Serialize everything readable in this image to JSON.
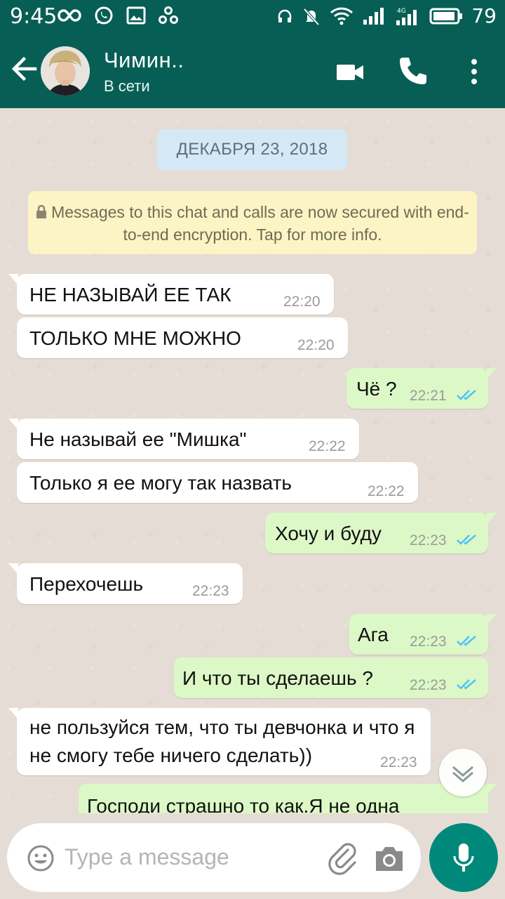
{
  "status_bar": {
    "time": "9:45",
    "battery_level": "79",
    "left_icons": [
      "infinity-icon",
      "whatsapp-icon",
      "gallery-icon",
      "share-icon"
    ],
    "right_icons": [
      "headset-icon",
      "mute-icon",
      "wifi-icon",
      "signal-icon",
      "signal-4g-icon",
      "battery-icon"
    ]
  },
  "header": {
    "contact_name": "Чимин..",
    "contact_status": "В сети",
    "actions": [
      "video-call-icon",
      "call-icon",
      "more-icon"
    ]
  },
  "chat": {
    "date_label": "ДЕКАБРЯ 23, 2018",
    "encryption_notice": "Messages to this chat and calls are now secured with end-to-end encryption. Tap for more info.",
    "messages": [
      {
        "direction": "in",
        "text": "НЕ НАЗЫВАЙ ЕЕ ТАК",
        "time": "22:20"
      },
      {
        "direction": "in",
        "text": "ТОЛЬКО МНЕ МОЖНО",
        "time": "22:20"
      },
      {
        "direction": "out",
        "text": "Чё ?",
        "time": "22:21",
        "status": "read"
      },
      {
        "direction": "in",
        "text": "Не называй ее \"Мишка\"",
        "time": "22:22"
      },
      {
        "direction": "in",
        "text": "Только я ее могу так назвать",
        "time": "22:22"
      },
      {
        "direction": "out",
        "text": "Хочу и буду",
        "time": "22:23",
        "status": "read"
      },
      {
        "direction": "in",
        "text": "Перехочешь",
        "time": "22:23"
      },
      {
        "direction": "out",
        "text": "Ага",
        "time": "22:23",
        "status": "read"
      },
      {
        "direction": "out",
        "text": "И что ты сделаешь ?",
        "time": "22:23",
        "status": "read"
      },
      {
        "direction": "in",
        "text": "не пользуйся тем, что ты девчонка и что я не смогу тебе ничего сделать))",
        "time": "22:23"
      },
      {
        "direction": "out",
        "text": "Господи страшно то как.Я не одна",
        "time": ""
      }
    ]
  },
  "input_bar": {
    "placeholder": "Type a message"
  },
  "colors": {
    "header": "#075e54",
    "incoming_bubble": "#ffffff",
    "outgoing_bubble": "#dcf8c6",
    "read_ticks": "#4fc3f7",
    "mic_button": "#00897b",
    "chat_background": "#e5ddd5"
  }
}
